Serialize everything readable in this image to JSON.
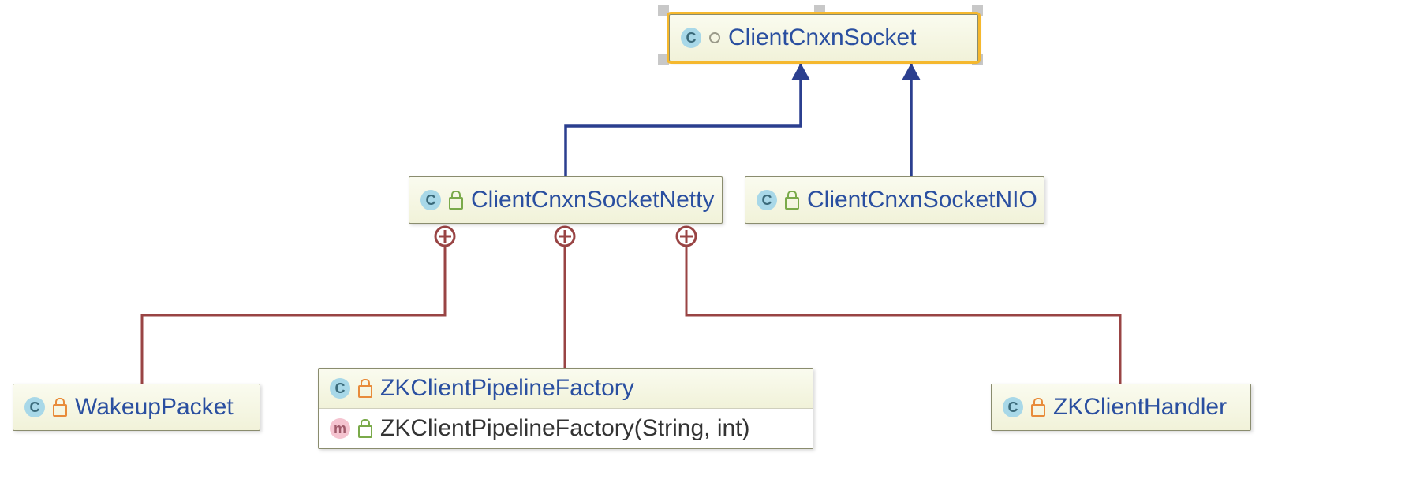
{
  "nodes": {
    "root": {
      "label": "ClientCnxnSocket",
      "iconLetter": "C",
      "abstract": true,
      "selected": true
    },
    "netty": {
      "label": "ClientCnxnSocketNetty",
      "iconLetter": "C",
      "visibility": "package"
    },
    "nio": {
      "label": "ClientCnxnSocketNIO",
      "iconLetter": "C",
      "visibility": "package"
    },
    "wakeup": {
      "label": "WakeupPacket",
      "iconLetter": "C",
      "visibility": "private"
    },
    "zkhandler": {
      "label": "ZKClientHandler",
      "iconLetter": "C",
      "visibility": "private"
    },
    "pipeline": {
      "titleLabel": "ZKClientPipelineFactory",
      "titleIcon": "C",
      "titleVisibility": "private",
      "methodLabel": "ZKClientPipelineFactory(String, int)",
      "methodIcon": "m",
      "methodVisibility": "package"
    }
  },
  "relations": {
    "inheritance": [
      {
        "from": "netty",
        "to": "root"
      },
      {
        "from": "nio",
        "to": "root"
      }
    ],
    "inner": [
      {
        "outer": "netty",
        "inner": "wakeup"
      },
      {
        "outer": "netty",
        "inner": "pipeline"
      },
      {
        "outer": "netty",
        "inner": "zkhandler"
      }
    ]
  },
  "colors": {
    "inheritLine": "#2b3f8f",
    "innerLine": "#994444",
    "selection": "#f5b82e"
  }
}
